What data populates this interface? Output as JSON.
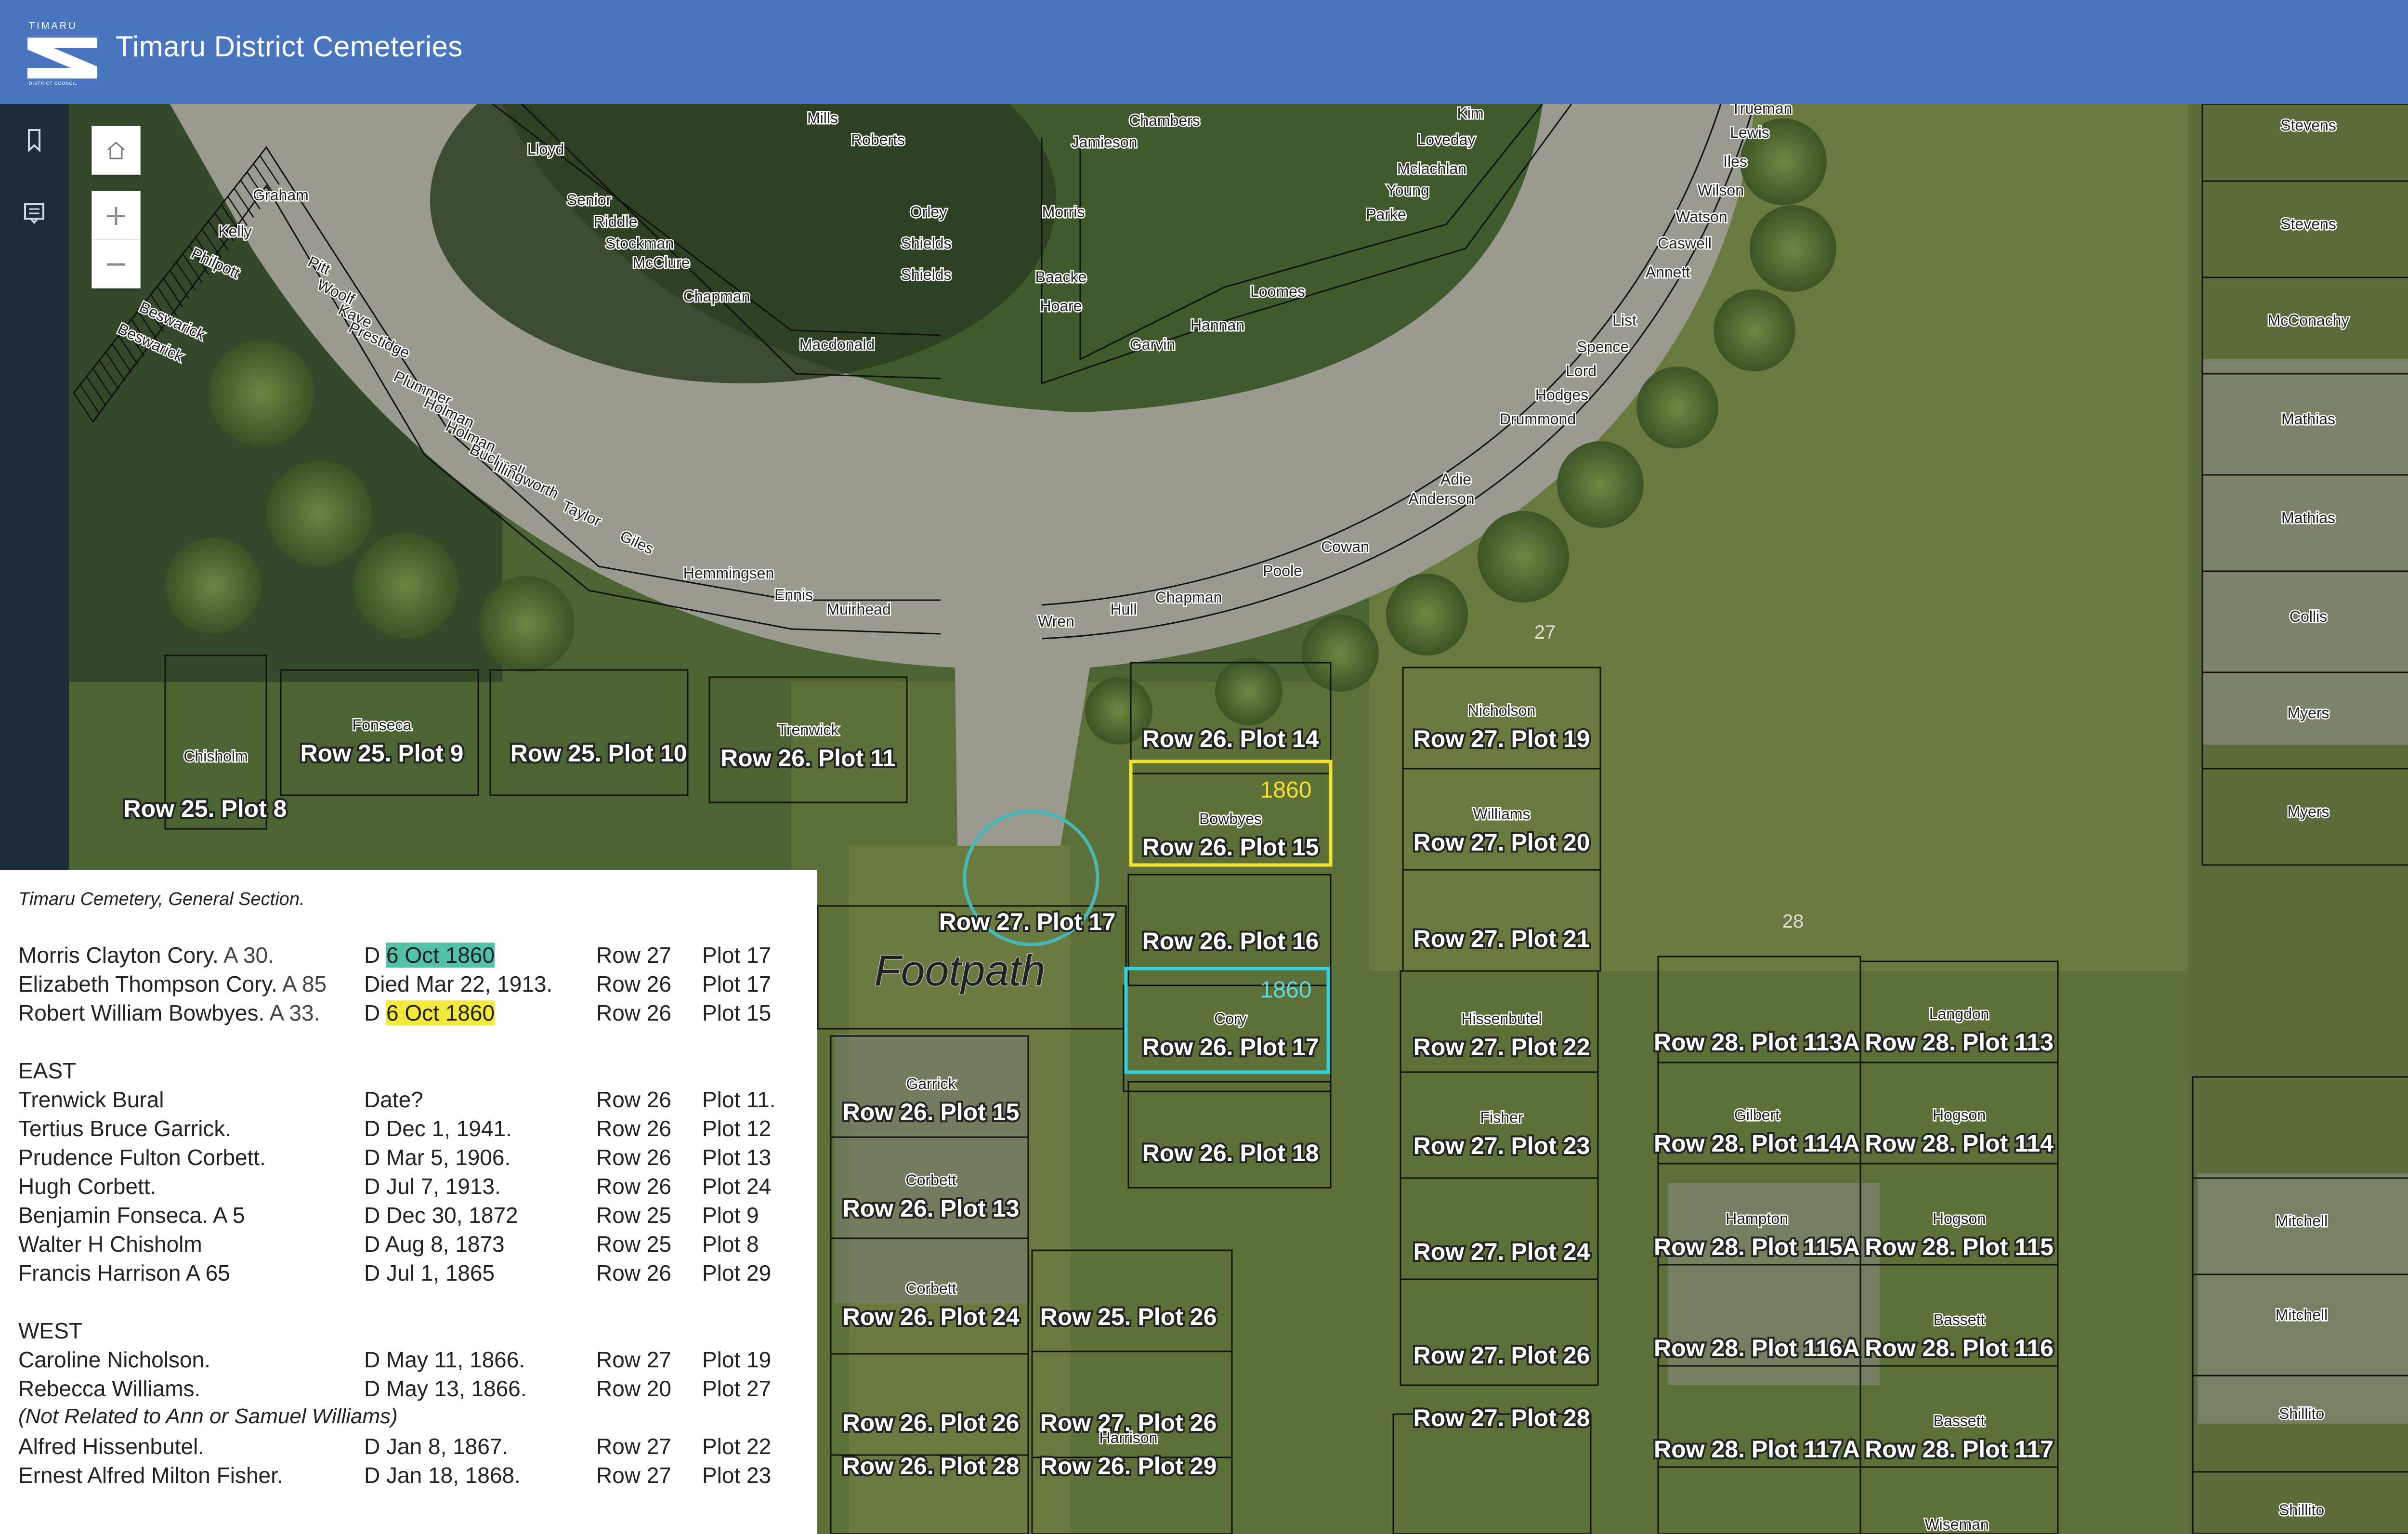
{
  "header": {
    "title": "Timaru District Cemeteries",
    "logo_top": "TIMARU",
    "logo_bottom": "DISTRICT COUNCIL",
    "color": "#4a76c0"
  },
  "sidebar": {
    "items": [
      {
        "name": "bookmark-icon"
      },
      {
        "name": "legend-icon"
      }
    ]
  },
  "map_controls": {
    "home": "home-icon",
    "zoom_in": "+",
    "zoom_out": "−"
  },
  "map": {
    "footpath_label": "Footpath",
    "section_numbers": [
      "27",
      "28"
    ],
    "plot_labels": [
      {
        "id": "r25p8",
        "text": "Row 25. Plot 8"
      },
      {
        "id": "r25p9",
        "text": "Row 25. Plot 9",
        "owner": "Fonseca"
      },
      {
        "id": "r25p10",
        "text": "Row 25. Plot 10"
      },
      {
        "id": "r26p11",
        "text": "Row 26. Plot 11",
        "owner": "Trenwick"
      },
      {
        "id": "r26p14",
        "text": "Row 26. Plot 14"
      },
      {
        "id": "r26p15",
        "text": "Row 26. Plot 15",
        "owner": "Bowbyes",
        "year": "1860"
      },
      {
        "id": "r27p17",
        "text": "Row 27. Plot 17"
      },
      {
        "id": "r26p16",
        "text": "Row 26. Plot 16"
      },
      {
        "id": "r26p17",
        "text": "Row 26. Plot 17",
        "owner": "Cory",
        "year": "1860"
      },
      {
        "id": "r26p18",
        "text": "Row 26. Plot 18"
      },
      {
        "id": "r26p15b",
        "text": "Row 26. Plot 15",
        "owner": "Garrick"
      },
      {
        "id": "r26p13",
        "text": "Row 26. Plot 13",
        "owner": "Corbett"
      },
      {
        "id": "r26p24",
        "text": "Row 26. Plot 24",
        "owner": "Corbett"
      },
      {
        "id": "r25p26",
        "text": "Row 25. Plot 26"
      },
      {
        "id": "r26p26",
        "text": "Row 26. Plot 26"
      },
      {
        "id": "r27p26b",
        "text": "Row 27. Plot 26"
      },
      {
        "id": "r26p28",
        "text": "Row 26. Plot 28"
      },
      {
        "id": "r26p29",
        "text": "Row 26. Plot 29",
        "owner": "Harrison"
      },
      {
        "id": "r27p19",
        "text": "Row 27. Plot 19",
        "owner": "Nicholson"
      },
      {
        "id": "r27p20",
        "text": "Row 27. Plot 20",
        "owner": "Williams"
      },
      {
        "id": "r27p21",
        "text": "Row 27. Plot 21"
      },
      {
        "id": "r27p22",
        "text": "Row 27. Plot 22",
        "owner": "Hissenbutel"
      },
      {
        "id": "r27p23",
        "text": "Row 27. Plot 23",
        "owner": "Fisher"
      },
      {
        "id": "r27p24",
        "text": "Row 27. Plot 24"
      },
      {
        "id": "r27p26",
        "text": "Row 27. Plot 26"
      },
      {
        "id": "r27p28",
        "text": "Row 27. Plot 28"
      },
      {
        "id": "r28p113a",
        "text": "Row 28. Plot 113A"
      },
      {
        "id": "r28p113",
        "text": "Row 28. Plot 113",
        "owner": "Langdon"
      },
      {
        "id": "r28p114a",
        "text": "Row 28. Plot 114A",
        "owner": "Gilbert"
      },
      {
        "id": "r28p114",
        "text": "Row 28. Plot 114",
        "owner": "Hogson"
      },
      {
        "id": "r28p115a",
        "text": "Row 28. Plot 115A",
        "owner": "Hampton"
      },
      {
        "id": "r28p115",
        "text": "Row 28. Plot 115",
        "owner": "Hogson"
      },
      {
        "id": "r28p116a",
        "text": "Row 28. Plot 116A"
      },
      {
        "id": "r28p116",
        "text": "Row 28. Plot 116",
        "owner": "Bassett"
      },
      {
        "id": "r28p117a",
        "text": "Row 28. Plot 117A"
      },
      {
        "id": "r28p117",
        "text": "Row 28. Plot 117",
        "owner": "Bassett"
      }
    ],
    "other_names": {
      "chisholm": "Chisholm",
      "wiseman": "Wiseman",
      "right_col": [
        "Stevens",
        "Stevens",
        "McConachy",
        "Mathias",
        "Mathias",
        "Collis",
        "Myers",
        "Myers"
      ],
      "right_col2": [
        "Mitchell",
        "Mitchell",
        "Shillito",
        "Shillito"
      ],
      "left_arc": [
        "Graham",
        "Kelly",
        "Philpott",
        "Pitt",
        "Woolf",
        "Kaye",
        "Beswarick",
        "Beswarick",
        "Prestidge",
        "Plummer",
        "Holman",
        "Holman",
        "Bucknell",
        "Illingworth",
        "Taylor",
        "Giles",
        "Hemmingsen",
        "Ennis",
        "Muirhead"
      ],
      "top_left": [
        "Mills",
        "Roberts",
        "Lloyd",
        "Senior",
        "Riddle",
        "Stockman",
        "McClure",
        "Chapman",
        "Orley",
        "Shields",
        "Shields",
        "Macdonald"
      ],
      "top_right": [
        "Chambers",
        "Jamieson",
        "Morris",
        "Baacke",
        "Hoare",
        "Garvin",
        "Hannan",
        "Loomes",
        "Kim",
        "Loveday",
        "Mclachlan",
        "Young",
        "Parke"
      ],
      "right_arc": [
        "Trueman",
        "Lewis",
        "Iles",
        "Wilson",
        "Watson",
        "Caswell",
        "Annett",
        "List",
        "Spence",
        "Lord",
        "Hodges",
        "Drummond",
        "Adie",
        "Anderson",
        "Cowan",
        "Poole",
        "Chapman",
        "Hull",
        "Wren"
      ]
    }
  },
  "panel": {
    "title": "Timaru Cemetery, General Section.",
    "general": [
      {
        "name": "Morris Clayton Cory.",
        "age": " A 30.",
        "date_prefix": "D ",
        "date": "6 Oct 1860",
        "highlight": "cyan",
        "row": "Row 27",
        "plot": "Plot 17"
      },
      {
        "name": "Elizabeth Thompson Cory.",
        "age": " A 85",
        "date_prefix": "",
        "date": "Died Mar 22, 1913.",
        "highlight": "",
        "row": "Row 26",
        "plot": "Plot 17"
      },
      {
        "name": "Robert William Bowbyes.",
        "age": " A 33.",
        "date_prefix": "D ",
        "date": "6 Oct 1860",
        "highlight": "yellow",
        "row": "Row 26",
        "plot": "Plot 15"
      }
    ],
    "east_heading": "EAST",
    "east": [
      {
        "name": "Trenwick Bural",
        "date": "Date?",
        "row": "Row 26",
        "plot": "Plot 11."
      },
      {
        "name": "Tertius Bruce Garrick.",
        "date": "D Dec 1, 1941.",
        "row": "Row 26",
        "plot": "Plot 12"
      },
      {
        "name": "Prudence Fulton Corbett.",
        "date": "D Mar 5, 1906.",
        "row": "Row 26",
        "plot": "Plot 13"
      },
      {
        "name": "Hugh Corbett.",
        "date": "D Jul 7, 1913.",
        "row": "Row 26",
        "plot": "Plot 24"
      },
      {
        "name": "Benjamin Fonseca. A 5",
        "date": "D Dec 30, 1872",
        "row": "Row 25",
        "plot": "Plot 9"
      },
      {
        "name": "Walter H Chisholm",
        "date": "D Aug 8, 1873",
        "row": "Row 25",
        "plot": "Plot 8"
      },
      {
        "name": "Francis Harrison A 65",
        "date": "D Jul 1, 1865",
        "row": "Row 26",
        "plot": "Plot 29"
      }
    ],
    "west_heading": "WEST",
    "west": [
      {
        "name": "Caroline Nicholson.",
        "date": "D May 11, 1866.",
        "row": "Row 27",
        "plot": "Plot 19"
      },
      {
        "name": "Rebecca Williams.",
        "date": "D May 13, 1866.",
        "row": "Row 20",
        "plot": "Plot 27"
      }
    ],
    "note": "(Not Related to Ann or Samuel Williams)",
    "west2": [
      {
        "name": "Alfred Hissenbutel.",
        "date": "D Jan 8, 1867.",
        "row": "Row 27",
        "plot": "Plot 22"
      },
      {
        "name": "Ernest Alfred Milton Fisher.",
        "date": "D Jan 18, 1868.",
        "row": "Row 27",
        "plot": "Plot 23"
      }
    ]
  },
  "colors": {
    "selected_yellow": "#f5e12c",
    "selected_cyan": "#2fd4e0",
    "search_circle": "#47b8b8"
  }
}
